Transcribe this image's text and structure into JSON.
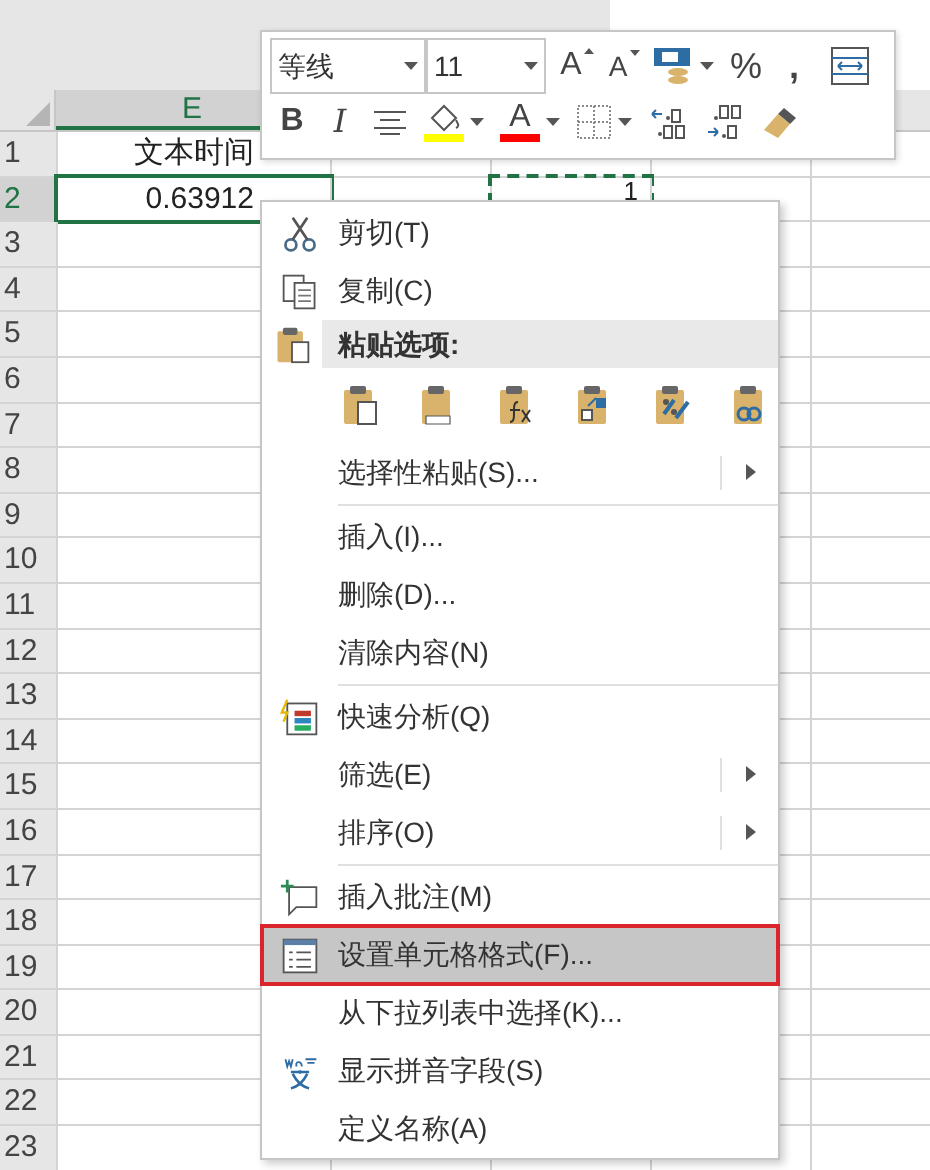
{
  "sheet": {
    "column_header": "E",
    "rows": [
      {
        "number": "1",
        "selected": false,
        "column_1": {
          "text": "文本时间",
          "kind": "text",
          "selected": false
        }
      },
      {
        "number": "2",
        "selected": true,
        "column_1": {
          "text": "0.63912",
          "kind": "number",
          "selected": true
        },
        "column_3": {
          "text": "1",
          "copied": true
        }
      },
      {
        "number": "3",
        "selected": false
      },
      {
        "number": "4",
        "selected": false
      },
      {
        "number": "5",
        "selected": false
      },
      {
        "number": "6",
        "selected": false
      },
      {
        "number": "7",
        "selected": false
      },
      {
        "number": "8",
        "selected": false
      },
      {
        "number": "9",
        "selected": false
      },
      {
        "number": "10",
        "selected": false
      },
      {
        "number": "11",
        "selected": false
      },
      {
        "number": "12",
        "selected": false
      },
      {
        "number": "13",
        "selected": false
      },
      {
        "number": "14",
        "selected": false
      },
      {
        "number": "15",
        "selected": false
      },
      {
        "number": "16",
        "selected": false
      },
      {
        "number": "17",
        "selected": false
      },
      {
        "number": "18",
        "selected": false
      },
      {
        "number": "19",
        "selected": false
      },
      {
        "number": "20",
        "selected": false
      },
      {
        "number": "21",
        "selected": false
      },
      {
        "number": "22",
        "selected": false
      },
      {
        "number": "23",
        "selected": false
      }
    ]
  },
  "mini_toolbar": {
    "font": "等线",
    "size": "11",
    "grow_font": "A",
    "shrink_font": "A",
    "percent": "%",
    "comma": ",",
    "bold": "B",
    "italic": "I",
    "font_color_letter": "A"
  },
  "context_menu": {
    "items": [
      {
        "kind": "item",
        "label": "剪切(T)",
        "submenu": false,
        "selected": false,
        "outlined": false
      },
      {
        "kind": "item",
        "label": "复制(C)",
        "submenu": false,
        "selected": false,
        "outlined": false
      },
      {
        "kind": "header",
        "label": "粘贴选项:"
      },
      {
        "kind": "paste_options"
      },
      {
        "kind": "item",
        "label": "选择性粘贴(S)...",
        "submenu": true,
        "selected": false,
        "outlined": false
      },
      {
        "kind": "separator"
      },
      {
        "kind": "item",
        "label": "插入(I)...",
        "submenu": false,
        "selected": false,
        "outlined": false
      },
      {
        "kind": "item",
        "label": "删除(D)...",
        "submenu": false,
        "selected": false,
        "outlined": false
      },
      {
        "kind": "item",
        "label": "清除内容(N)",
        "submenu": false,
        "selected": false,
        "outlined": false
      },
      {
        "kind": "separator"
      },
      {
        "kind": "item",
        "label": "快速分析(Q)",
        "submenu": false,
        "selected": false,
        "outlined": false
      },
      {
        "kind": "item",
        "label": "筛选(E)",
        "submenu": true,
        "selected": false,
        "outlined": false
      },
      {
        "kind": "item",
        "label": "排序(O)",
        "submenu": true,
        "selected": false,
        "outlined": false
      },
      {
        "kind": "separator"
      },
      {
        "kind": "item",
        "label": "插入批注(M)",
        "submenu": false,
        "selected": false,
        "outlined": false
      },
      {
        "kind": "item",
        "label": "设置单元格格式(F)...",
        "submenu": false,
        "selected": true,
        "outlined": true
      },
      {
        "kind": "item",
        "label": "从下拉列表中选择(K)...",
        "submenu": false,
        "selected": false,
        "outlined": false
      },
      {
        "kind": "item",
        "label": "显示拼音字段(S)",
        "submenu": false,
        "selected": false,
        "outlined": false
      },
      {
        "kind": "item",
        "label": "定义名称(A)",
        "submenu": false,
        "selected": false,
        "outlined": false
      }
    ]
  }
}
